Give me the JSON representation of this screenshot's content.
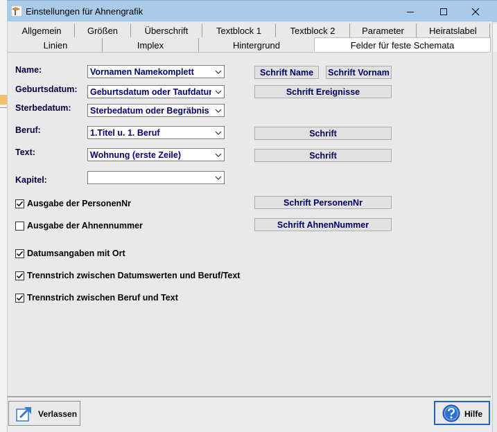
{
  "window": {
    "title": "Einstellungen für Ahnengrafik",
    "icons": {
      "app": "app-flag-icon",
      "minimize": "minimize-icon",
      "maximize": "maximize-icon",
      "close": "close-icon"
    }
  },
  "tabs": {
    "row1": [
      "Allgemein",
      "Größen",
      "Überschrift",
      "Textblock 1",
      "Textblock 2",
      "Parameter",
      "Heiratslabel"
    ],
    "row2": [
      "Linien",
      "Implex",
      "Hintergrund",
      "Felder für feste Schemata"
    ],
    "active": "Felder für feste Schemata"
  },
  "fields": {
    "name": {
      "label": "Name:",
      "value": "Vornamen Namekomplett"
    },
    "geburtsdatum": {
      "label": "Geburtsdatum:",
      "value": "Geburtsdatum oder Taufdatum"
    },
    "sterbedatum": {
      "label": "Sterbedatum:",
      "value": "Sterbedatum oder Begräbnis"
    },
    "beruf": {
      "label": "Beruf:",
      "value": "1.Titel u. 1. Beruf"
    },
    "text": {
      "label": "Text:",
      "value": "Wohnung (erste Zeile)"
    },
    "kapitel": {
      "label": "Kapitel:",
      "value": ""
    }
  },
  "font_buttons": {
    "schrift_name": "Schrift Name",
    "schrift_vorname": "Schrift Vornam",
    "schrift_ereignisse": "Schrift Ereignisse",
    "schrift_beruf": "Schrift",
    "schrift_text": "Schrift",
    "schrift_personennr": "Schrift PersonenNr",
    "schrift_ahnennummer": "Schrift AhnenNummer"
  },
  "checkboxes": {
    "personennr": {
      "label": "Ausgabe der PersonenNr",
      "checked": true
    },
    "ahnennummer": {
      "label": "Ausgabe der Ahnennummer",
      "checked": false
    },
    "datum_ort": {
      "label": "Datumsangaben mit Ort",
      "checked": true
    },
    "trenn_datum": {
      "label": "Trennstrich zwischen Datumswerten und Beruf/Text",
      "checked": true
    },
    "trenn_beruf": {
      "label": "Trennstrich zwischen Beruf und Text",
      "checked": true
    }
  },
  "footer": {
    "exit_label": "Verlassen",
    "help_label": "Hilfe",
    "exit_icon": "exit-arrow-icon",
    "help_icon": "help-question-icon"
  },
  "colors": {
    "titlebar": "#a9cbea",
    "label_text": "#000040",
    "help_border": "#1e63c6"
  }
}
